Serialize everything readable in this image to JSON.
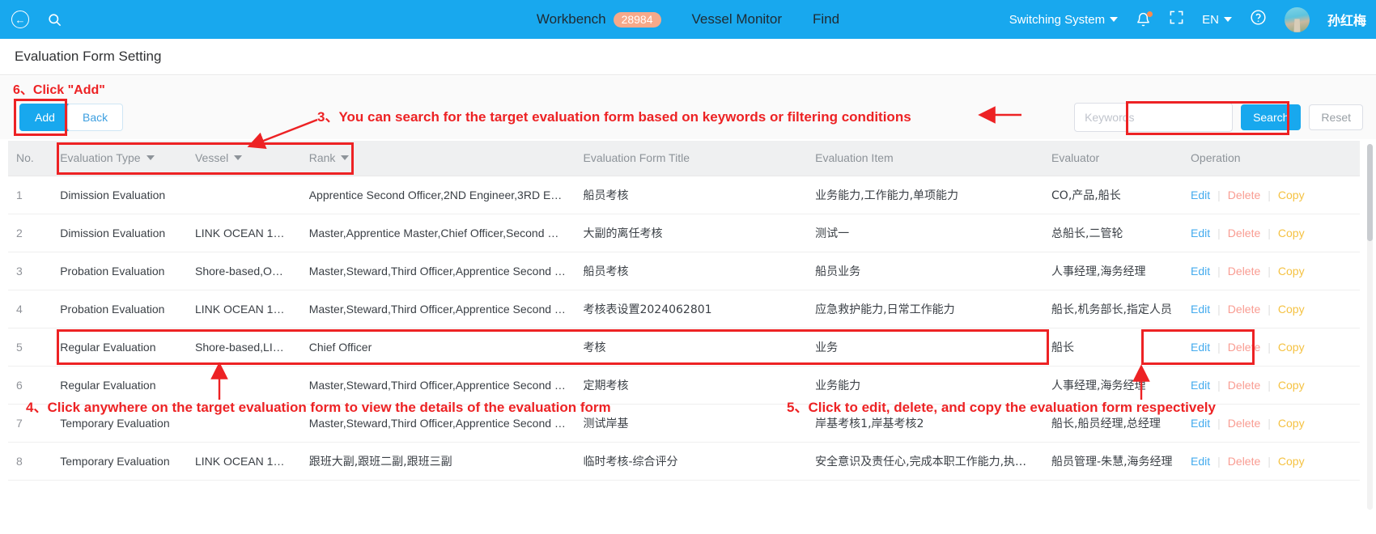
{
  "topbar": {
    "back_icon": "circle-back-icon",
    "search_icon": "search-icon",
    "nav": [
      {
        "label": "Workbench",
        "badge": "28984"
      },
      {
        "label": "Vessel Monitor",
        "badge": ""
      },
      {
        "label": "Find",
        "badge": ""
      }
    ],
    "switching_system": "Switching System",
    "bell_icon": "bell-icon",
    "fullscreen_icon": "fullscreen-icon",
    "language": "EN",
    "help_icon": "help-icon",
    "username": "孙红梅"
  },
  "page": {
    "title": "Evaluation Form Setting"
  },
  "toolbar": {
    "add_label": "Add",
    "back_label": "Back"
  },
  "search": {
    "placeholder": "Keywords",
    "value": "",
    "search_label": "Search",
    "reset_label": "Reset"
  },
  "table": {
    "headers": {
      "no": "No.",
      "evaluation_type": "Evaluation Type",
      "vessel": "Vessel",
      "rank": "Rank",
      "title": "Evaluation Form Title",
      "item": "Evaluation Item",
      "evaluator": "Evaluator",
      "operation": "Operation"
    },
    "op": {
      "edit": "Edit",
      "delete": "Delete",
      "copy": "Copy"
    },
    "rows": [
      {
        "no": "1",
        "type": "Dimission Evaluation",
        "vessel": "",
        "rank": "Apprentice Second Officer,2ND Engineer,3RD En…",
        "title": "船员考核",
        "item": "业务能力,工作能力,单项能力",
        "evaluator": "CO,产品,船长"
      },
      {
        "no": "2",
        "type": "Dimission Evaluation",
        "vessel": "LINK OCEAN 1…",
        "rank": "Master,Apprentice Master,Chief Officer,Second Off…",
        "title": "大副的离任考核",
        "item": "测试一",
        "evaluator": "总船长,二管轮"
      },
      {
        "no": "3",
        "type": "Probation Evaluation",
        "vessel": "Shore-based,O…",
        "rank": "Master,Steward,Third Officer,Apprentice Second …",
        "title": "船员考核",
        "item": "船员业务",
        "evaluator": "人事经理,海务经理"
      },
      {
        "no": "4",
        "type": "Probation Evaluation",
        "vessel": "LINK OCEAN 1…",
        "rank": "Master,Steward,Third Officer,Apprentice Second …",
        "title": "考核表设置2024062801",
        "item": "应急救护能力,日常工作能力",
        "evaluator": "船长,机务部长,指定人员"
      },
      {
        "no": "5",
        "type": "Regular Evaluation",
        "vessel": "Shore-based,LI…",
        "rank": "Chief Officer",
        "title": "考核",
        "item": "业务",
        "evaluator": "船长"
      },
      {
        "no": "6",
        "type": "Regular Evaluation",
        "vessel": "",
        "rank": "Master,Steward,Third Officer,Apprentice Second …",
        "title": "定期考核",
        "item": "业务能力",
        "evaluator": "人事经理,海务经理"
      },
      {
        "no": "7",
        "type": "Temporary Evaluation",
        "vessel": "",
        "rank": "Master,Steward,Third Officer,Apprentice Second …",
        "title": "测试岸基",
        "item": "岸基考核1,岸基考核2",
        "evaluator": "船长,船员经理,总经理"
      },
      {
        "no": "8",
        "type": "Temporary Evaluation",
        "vessel": "LINK OCEAN 1…",
        "rank": "跟班大副,跟班二副,跟班三副",
        "title": "临时考核-综合评分",
        "item": "安全意识及责任心,完成本职工作能力,执…",
        "evaluator": "船员管理-朱慧,海务经理"
      }
    ]
  },
  "annotations": {
    "a6": "6、Click \"Add\"",
    "a3": "3、You can search for the target evaluation form based on keywords or filtering conditions",
    "a4": "4、Click anywhere on the target evaluation form to view the details of the evaluation form",
    "a5": "5、Click to edit, delete, and copy the evaluation form respectively"
  },
  "colors": {
    "brand_blue": "#18A8EE",
    "annotation_red": "#ED2224",
    "badge_orange": "#F7A98A",
    "edit_blue": "#44ABEE",
    "delete_red": "#F99C92",
    "copy_orange": "#F5C242"
  }
}
